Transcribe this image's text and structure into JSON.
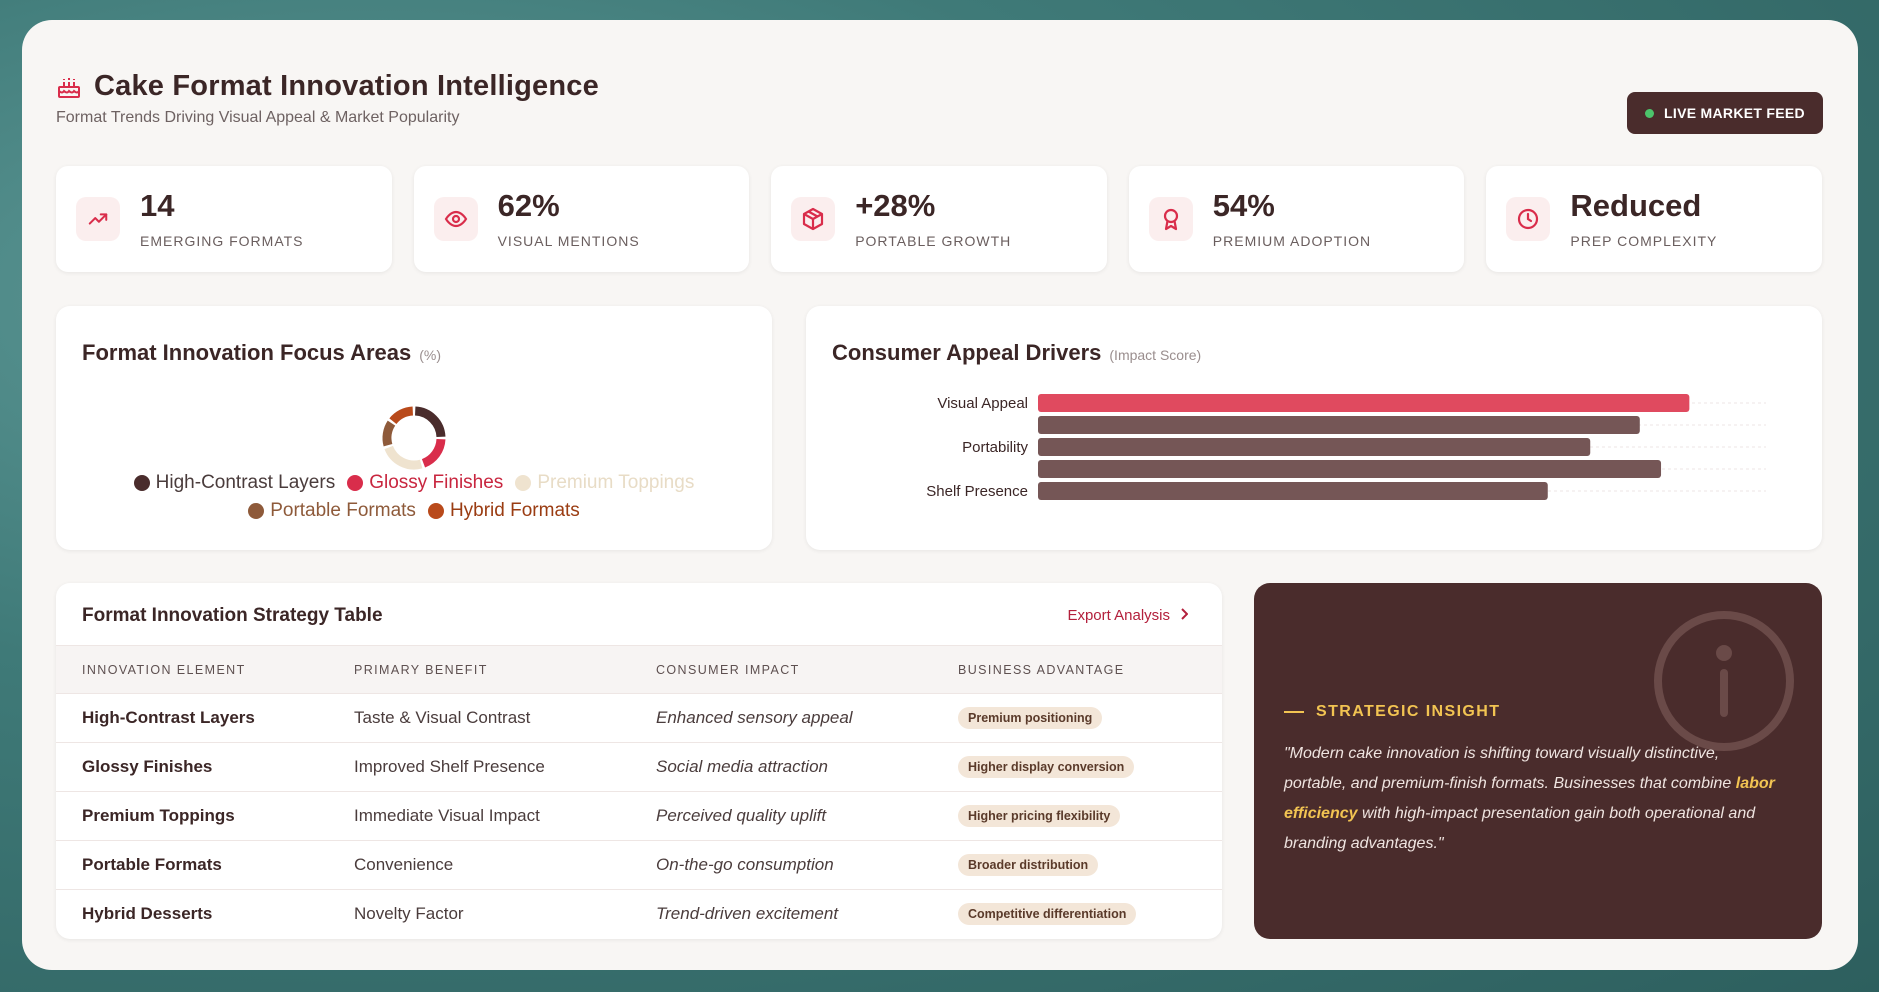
{
  "header": {
    "title": "Cake Format Innovation Intelligence",
    "subtitle": "Format Trends Driving Visual Appeal & Market Popularity",
    "live_label": "LIVE MARKET FEED",
    "icon": "cake-icon"
  },
  "kpis": [
    {
      "value": "14",
      "label": "EMERGING FORMATS",
      "icon": "trending-up-icon"
    },
    {
      "value": "62%",
      "label": "VISUAL MENTIONS",
      "icon": "eye-icon"
    },
    {
      "value": "+28%",
      "label": "PORTABLE GROWTH",
      "icon": "box-icon"
    },
    {
      "value": "54%",
      "label": "PREMIUM ADOPTION",
      "icon": "award-icon"
    },
    {
      "value": "Reduced",
      "label": "PREP COMPLEXITY",
      "icon": "clock-icon"
    }
  ],
  "donut_panel": {
    "title": "Format Innovation Focus Areas",
    "unit": "(%)"
  },
  "bar_panel": {
    "title": "Consumer Appeal Drivers",
    "unit": "(Impact Score)"
  },
  "chart_data": [
    {
      "type": "pie",
      "labels": [
        "High-Contrast Layers",
        "Glossy Finishes",
        "Premium Toppings",
        "Portable Formats",
        "Hybrid Formats"
      ],
      "values": [
        25,
        20,
        25,
        15,
        15
      ],
      "colors": [
        "#4a2c2c",
        "#d92d4b",
        "#efe3cf",
        "#8e5a3a",
        "#b94a1b"
      ],
      "legend": "bottom"
    },
    {
      "type": "bar",
      "orientation": "horizontal",
      "categories": [
        "Visual Appeal",
        "",
        "Portability",
        "",
        "Shelf Presence"
      ],
      "category_labels": [
        "Visual Appeal",
        "Portability",
        "Shelf Presence"
      ],
      "values": [
        92,
        85,
        78,
        88,
        72
      ],
      "xlim": [
        0,
        100
      ],
      "colors": [
        "#e04a5f",
        "#755656",
        "#755656",
        "#755656",
        "#755656"
      ],
      "grid": true
    }
  ],
  "table": {
    "title": "Format Innovation Strategy Table",
    "export_label": "Export Analysis",
    "headers": [
      "INNOVATION ELEMENT",
      "PRIMARY BENEFIT",
      "CONSUMER IMPACT",
      "BUSINESS ADVANTAGE"
    ],
    "rows": [
      [
        "High-Contrast Layers",
        "Taste & Visual Contrast",
        "Enhanced sensory appeal",
        "Premium positioning"
      ],
      [
        "Glossy Finishes",
        "Improved Shelf Presence",
        "Social media attraction",
        "Higher display conversion"
      ],
      [
        "Premium Toppings",
        "Immediate Visual Impact",
        "Perceived quality uplift",
        "Higher pricing flexibility"
      ],
      [
        "Portable Formats",
        "Convenience",
        "On-the-go consumption",
        "Broader distribution"
      ],
      [
        "Hybrid Desserts",
        "Novelty Factor",
        "Trend-driven excitement",
        "Competitive differentiation"
      ]
    ]
  },
  "insight": {
    "heading": "STRATEGIC INSIGHT",
    "text_before": "\"Modern cake innovation is shifting toward visually distinctive, portable, and premium-finish formats. Businesses that combine ",
    "highlight": "labor efficiency",
    "text_after": " with high-impact presentation gain both operational and branding advantages.\"",
    "icon": "info-icon"
  },
  "colors": {
    "accent": "#d92d4b",
    "brown": "#4a2c2c",
    "gold": "#f2c452",
    "live": "#4cc46b"
  }
}
